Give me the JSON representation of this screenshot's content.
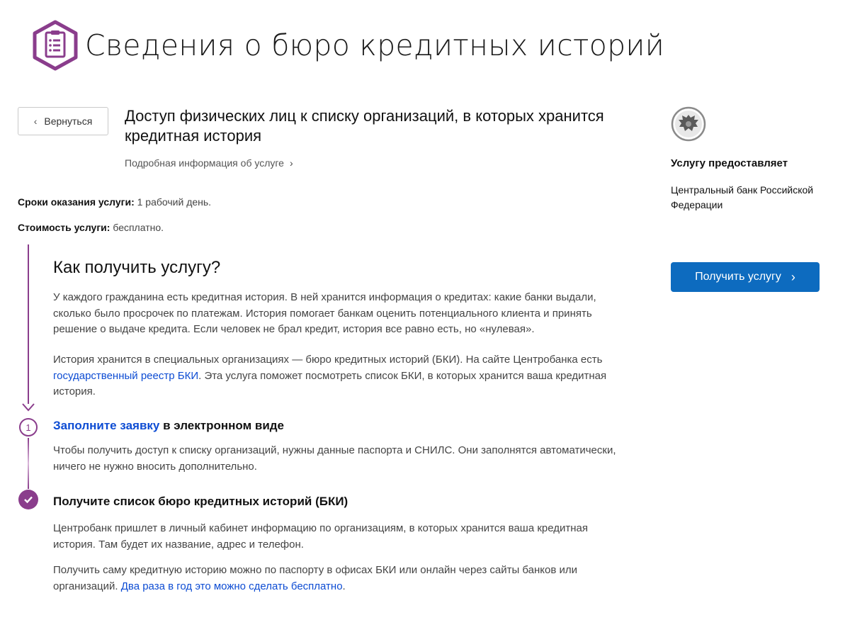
{
  "header": {
    "title": "Сведения о бюро кредитных историй",
    "icon": "clipboard-list-icon"
  },
  "back_button": {
    "label": "Вернуться"
  },
  "service": {
    "title": "Доступ физических лиц к списку организаций, в которых хранится кредитная история",
    "more_info": "Подробная информация об услуге"
  },
  "meta": {
    "term_label": "Сроки оказания услуги:",
    "term_value": "1 рабочий день.",
    "cost_label": "Стоимость услуги:",
    "cost_value": "бесплатно."
  },
  "provider": {
    "heading": "Услугу предоставляет",
    "name": "Центральный банк Российской Федерации",
    "emblem": "coat-of-arms-icon"
  },
  "get_service_button": {
    "label": "Получить услугу"
  },
  "how": {
    "heading": "Как получить услугу?",
    "para1": "У каждого гражданина есть кредитная история. В ней хранится информация о кредитах: какие банки выдали, сколько было просрочек по платежам. История помогает банкам оценить потенциального клиента и принять решение о выдаче кредита. Если человек не брал кредит, история все равно есть, но «нулевая».",
    "para2_before": "История хранится в специальных организациях — бюро кредитных историй (БКИ). На сайте Центробанка есть ",
    "para2_link": "государственный реестр БКИ",
    "para2_after": ". Эта услуга поможет посмотреть список БКИ, в которых хранится ваша кредитная история."
  },
  "steps": [
    {
      "number": "1",
      "title_link": "Заполните заявку",
      "title_rest": " в электронном виде",
      "text": "Чтобы получить доступ к списку организаций, нужны данные паспорта и СНИЛС. Они заполнятся автоматически, ничего не нужно вносить дополнительно."
    },
    {
      "title": "Получите список бюро кредитных историй (БКИ)",
      "text1": "Центробанк пришлет в личный кабинет информацию по организациям, в которых хранится ваша кредитная история. Там будет их название, адрес и телефон.",
      "text2_before": "Получить саму кредитную историю можно по паспорту в офисах БКИ или онлайн через сайты банков или организаций. ",
      "text2_link": "Два раза в год это можно сделать бесплатно",
      "text2_after": "."
    }
  ],
  "colors": {
    "accent": "#8a3d8c",
    "button": "#0d6bbf",
    "link": "#0d4cd3"
  }
}
